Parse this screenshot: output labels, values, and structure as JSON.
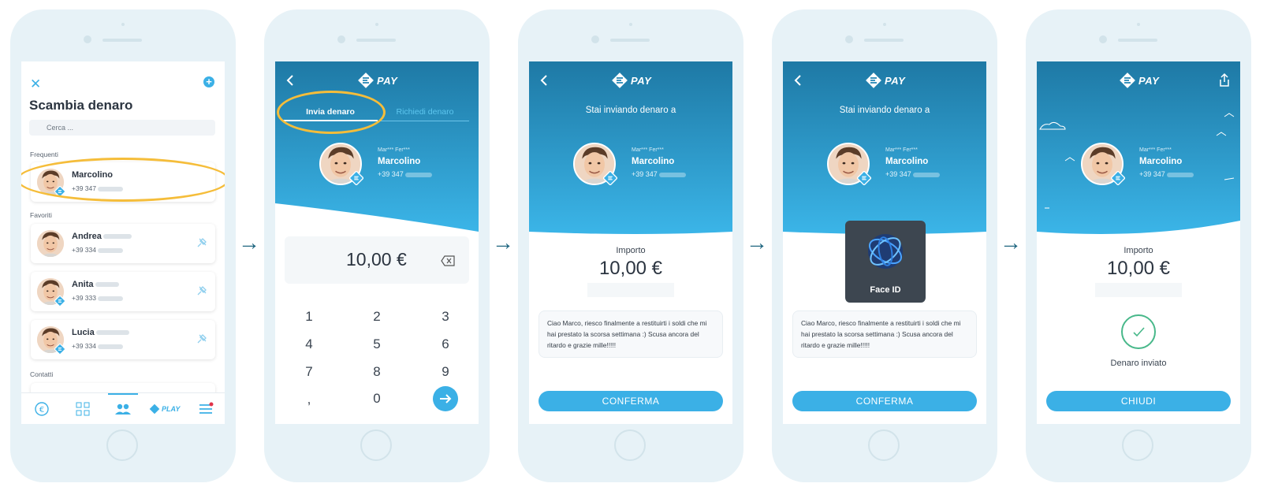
{
  "arrow_glyph": "→",
  "brand": {
    "logo_text": "PAY",
    "accent": "#3bb0e6",
    "header_top": "#1e79a5",
    "header_bottom": "#3bb5e8",
    "highlight": "#f5bd3a"
  },
  "screen1": {
    "title": "Scambia denaro",
    "search_placeholder": "Cerca ...",
    "sections": {
      "frequent": "Frequenti",
      "favorites": "Favoriti",
      "contacts": "Contatti"
    },
    "frequent": [
      {
        "name": "Marcolino",
        "phone": "+39 347"
      }
    ],
    "favorites": [
      {
        "name": "Andrea",
        "phone": "+39 334"
      },
      {
        "name": "Anita",
        "phone": "+39 333"
      },
      {
        "name": "Lucia",
        "phone": "+39 334"
      }
    ],
    "tabbar": [
      "euro-icon",
      "grid-icon",
      "people-icon",
      "play-icon",
      "menu-icon"
    ],
    "tab_play_label": "PLAY"
  },
  "screen2": {
    "tab_send": "Invia denaro",
    "tab_request": "Richiedi denaro",
    "contact_mask": "Mar*** Fer***",
    "contact_name": "Marcolino",
    "contact_phone": "+39 347",
    "amount": "10,00 €",
    "keys": [
      "1",
      "2",
      "3",
      "4",
      "5",
      "6",
      "7",
      "8",
      "9",
      ",",
      "0"
    ]
  },
  "screen3": {
    "sending_to": "Stai inviando denaro a",
    "contact_mask": "Mar*** Fer***",
    "contact_name": "Marcolino",
    "contact_phone": "+39 347",
    "amount_label": "Importo",
    "amount": "10,00 €",
    "message": "Ciao Marco, riesco finalmente a restituirti i soldi che mi hai prestato la scorsa settimana :) Scusa ancora del ritardo e grazie mille!!!!!",
    "button": "CONFERMA"
  },
  "screen4": {
    "sending_to": "Stai inviando denaro a",
    "contact_mask": "Mar*** Fer***",
    "contact_name": "Marcolino",
    "contact_phone": "+39 347",
    "faceid_label": "Face ID",
    "message": "Ciao Marco, riesco finalmente a restituirti i soldi che mi hai prestato la scorsa settimana :) Scusa ancora del ritardo e grazie mille!!!!!",
    "button": "CONFERMA"
  },
  "screen5": {
    "contact_mask": "Mar*** Fer***",
    "contact_name": "Marcolino",
    "contact_phone": "+39 347",
    "amount_label": "Importo",
    "amount": "10,00 €",
    "status": "Denaro inviato",
    "button": "CHIUDI"
  }
}
